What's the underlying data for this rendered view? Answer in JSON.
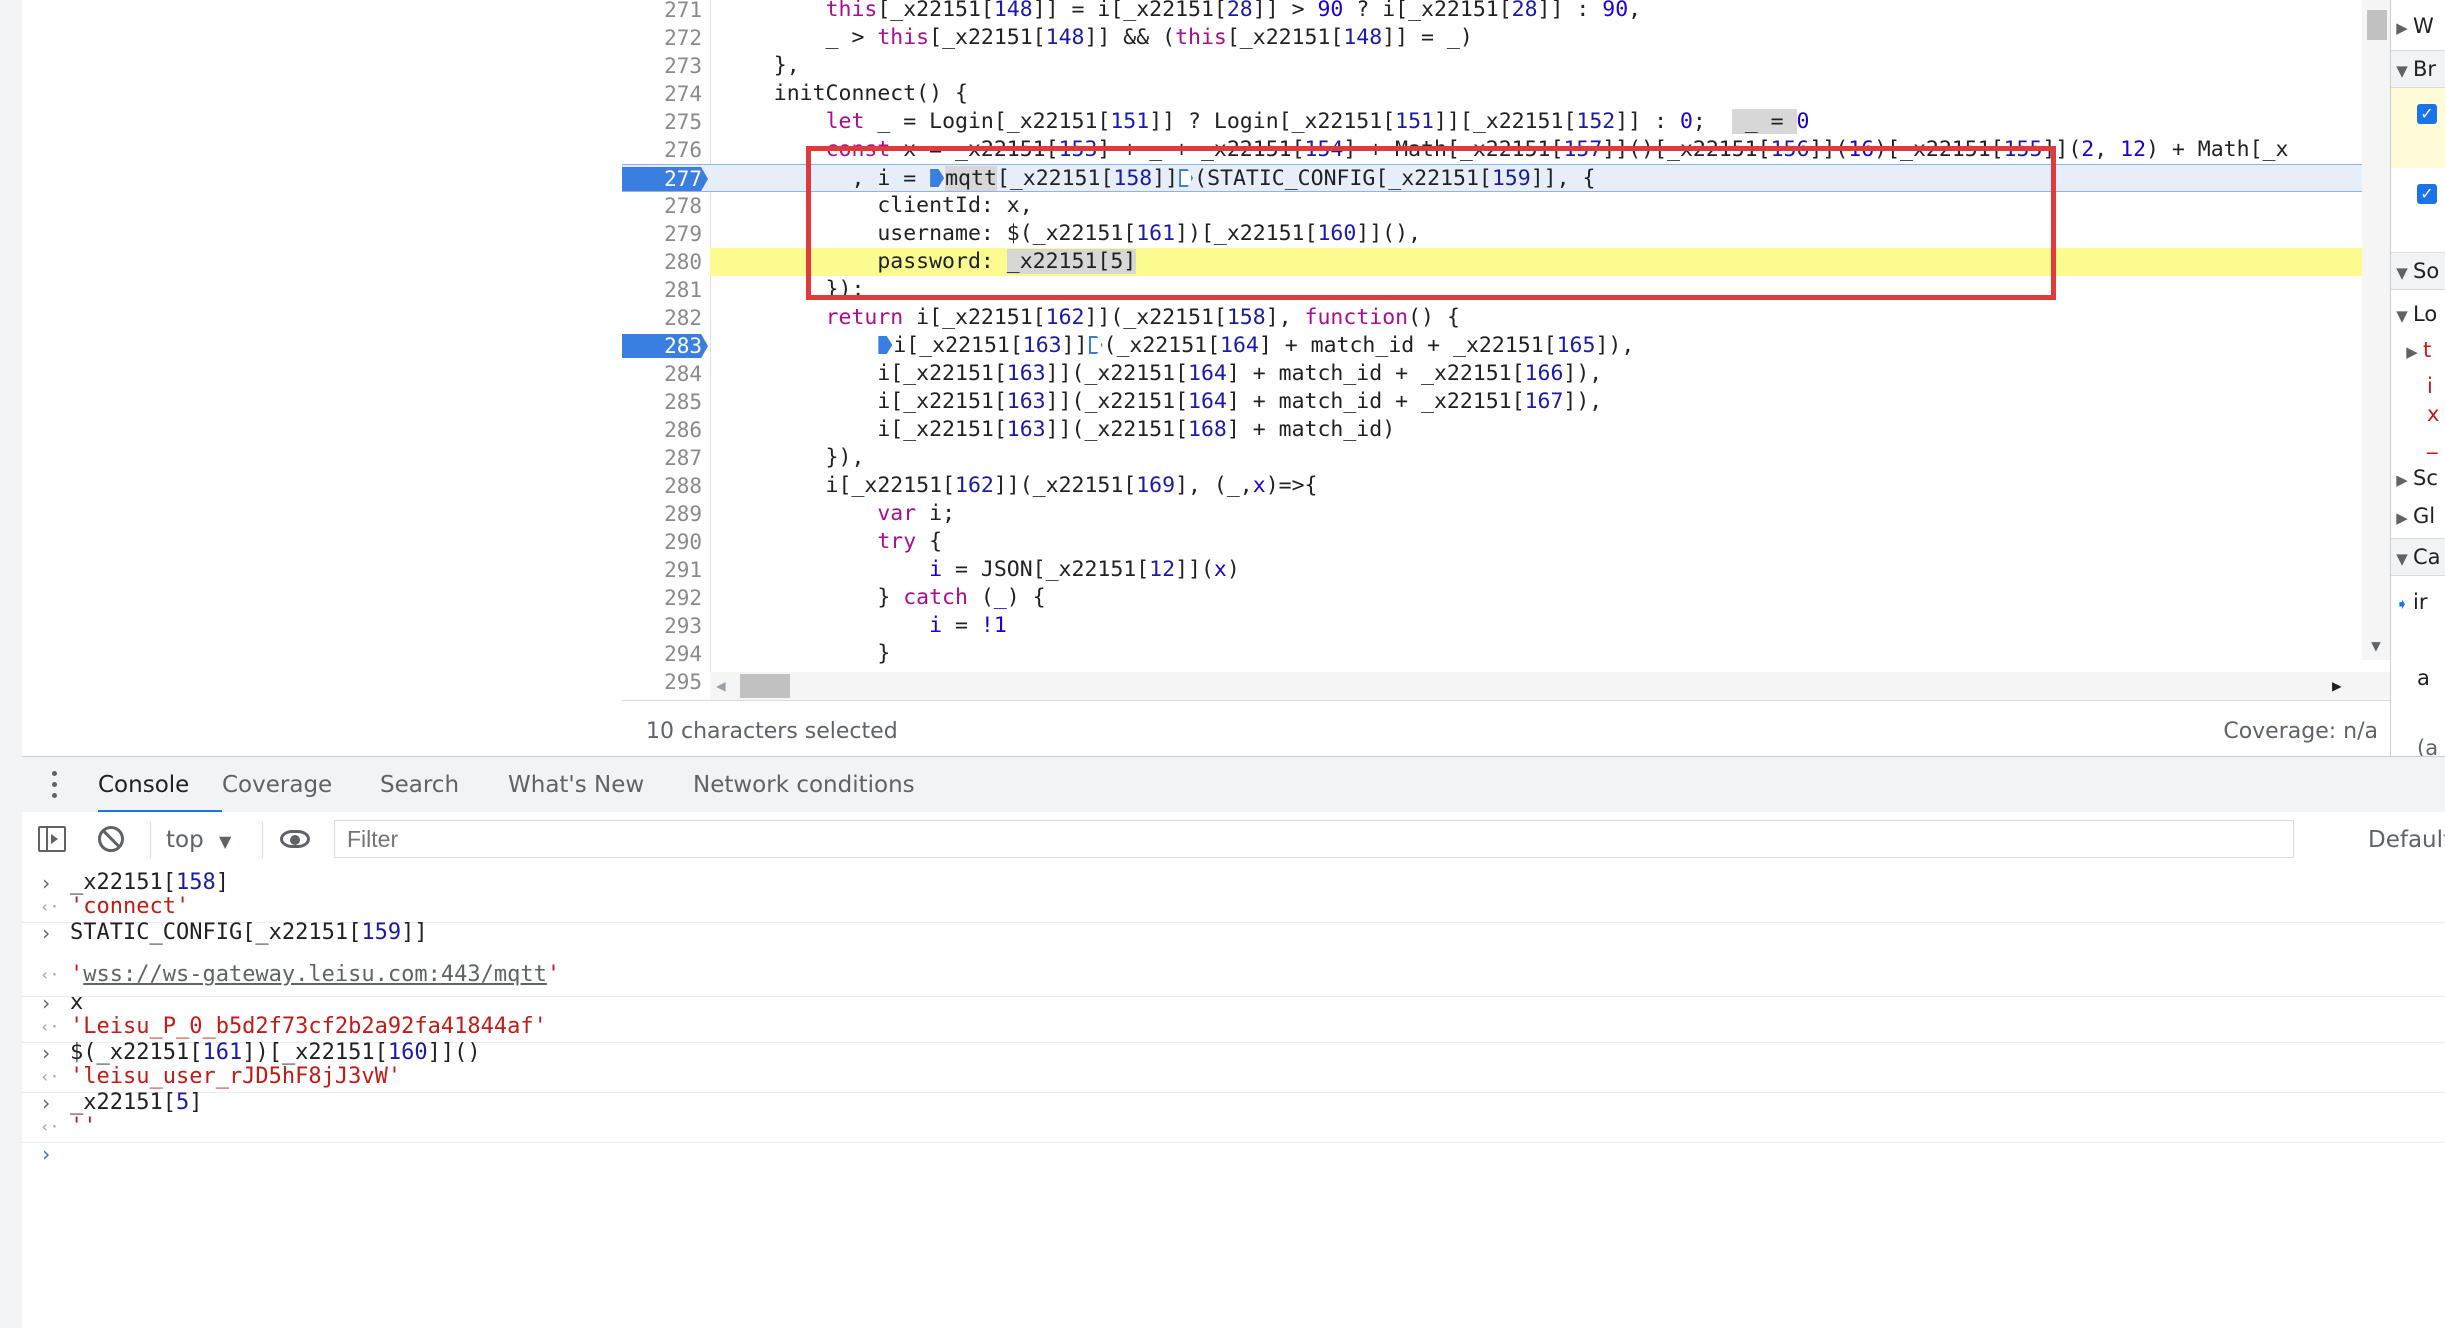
{
  "editor": {
    "lines": [
      {
        "n": "271",
        "code": [
          [
            "        ",
            ""
          ],
          [
            "this",
            "kw"
          ],
          [
            "[_x22151[",
            ""
          ],
          [
            "148",
            "idx"
          ],
          [
            "]] = i[_x22151[",
            ""
          ],
          [
            "28",
            "idx"
          ],
          [
            "]] > ",
            ""
          ],
          [
            "90",
            "num"
          ],
          [
            " ? i[_x22151[",
            ""
          ],
          [
            "28",
            "idx"
          ],
          [
            "]] : ",
            ""
          ],
          [
            "90",
            "num"
          ],
          [
            ",",
            ""
          ]
        ]
      },
      {
        "n": "272",
        "code": [
          [
            "        _ > ",
            ""
          ],
          [
            "this",
            "kw"
          ],
          [
            "[_x22151[",
            ""
          ],
          [
            "148",
            "idx"
          ],
          [
            "]] && (",
            ""
          ],
          [
            "this",
            "kw"
          ],
          [
            "[_x22151[",
            ""
          ],
          [
            "148",
            "idx"
          ],
          [
            "]] = _)",
            ""
          ]
        ]
      },
      {
        "n": "273",
        "code": [
          [
            "    },",
            ""
          ]
        ]
      },
      {
        "n": "274",
        "code": [
          [
            "    initConnect() {",
            ""
          ]
        ]
      },
      {
        "n": "275",
        "code": [
          [
            "        ",
            ""
          ],
          [
            "let",
            "kw"
          ],
          [
            " _ = Login[_x22151[",
            ""
          ],
          [
            "151",
            "idx"
          ],
          [
            "]] ? Login[_x22151[",
            ""
          ],
          [
            "151",
            "idx"
          ],
          [
            "]][_x22151[",
            ""
          ],
          [
            "152",
            "idx"
          ],
          [
            "]] : ",
            ""
          ],
          [
            "0",
            "num"
          ],
          [
            ";  ",
            ""
          ],
          [
            " _ = ",
            "sel"
          ],
          [
            "0",
            "num"
          ]
        ]
      },
      {
        "n": "276",
        "code": [
          [
            "        ",
            ""
          ],
          [
            "const",
            "kw"
          ],
          [
            " x = _x22151[",
            ""
          ],
          [
            "153",
            "idx"
          ],
          [
            "] + _ + _x22151[",
            ""
          ],
          [
            "154",
            "idx"
          ],
          [
            "] + Math[_x22151[",
            ""
          ],
          [
            "157",
            "idx"
          ],
          [
            "]]()[_x22151[",
            ""
          ],
          [
            "156",
            "idx"
          ],
          [
            "]](",
            ""
          ],
          [
            "16",
            "num"
          ],
          [
            ")[_x22151[",
            ""
          ],
          [
            "155",
            "idx"
          ],
          [
            "]](",
            ""
          ],
          [
            "2",
            "num"
          ],
          [
            ", ",
            ""
          ],
          [
            "12",
            "num"
          ],
          [
            ") + Math[_x",
            ""
          ]
        ]
      },
      {
        "n": "277",
        "code": [
          [
            "          , i = ",
            ""
          ],
          [
            "@in",
            ""
          ],
          [
            "mqtt",
            "sel"
          ],
          [
            "[_x22151[",
            ""
          ],
          [
            "158",
            "idx"
          ],
          [
            "]]",
            ""
          ],
          [
            "@out",
            ""
          ],
          [
            "(STATIC_CONFIG[_x22151[",
            ""
          ],
          [
            "159",
            "idx"
          ],
          [
            "]], {",
            ""
          ]
        ]
      },
      {
        "n": "278",
        "code": [
          [
            "            clientId: x,",
            ""
          ]
        ]
      },
      {
        "n": "279",
        "code": [
          [
            "            username: $(_x22151[",
            ""
          ],
          [
            "161",
            "idx"
          ],
          [
            "])[_x22151[",
            ""
          ],
          [
            "160",
            "idx"
          ],
          [
            "]](),",
            ""
          ]
        ]
      },
      {
        "n": "280",
        "code": [
          [
            "            password: ",
            ""
          ],
          [
            "_x22151[5]",
            "sel"
          ]
        ]
      },
      {
        "n": "281",
        "code": [
          [
            "        });",
            ""
          ]
        ]
      },
      {
        "n": "282",
        "code": [
          [
            "        ",
            ""
          ],
          [
            "return",
            "kw"
          ],
          [
            " i[_x22151[",
            ""
          ],
          [
            "162",
            "idx"
          ],
          [
            "]](_x22151[",
            ""
          ],
          [
            "158",
            "idx"
          ],
          [
            "], ",
            ""
          ],
          [
            "function",
            "kw"
          ],
          [
            "() {",
            ""
          ]
        ]
      },
      {
        "n": "283",
        "code": [
          [
            "            ",
            ""
          ],
          [
            "@in",
            ""
          ],
          [
            "i[_x22151[",
            ""
          ],
          [
            "163",
            "idx"
          ],
          [
            "]]",
            ""
          ],
          [
            "@out",
            ""
          ],
          [
            "(_x22151[",
            ""
          ],
          [
            "164",
            "idx"
          ],
          [
            "] + match_id + _x22151[",
            ""
          ],
          [
            "165",
            "idx"
          ],
          [
            "]),",
            ""
          ]
        ]
      },
      {
        "n": "284",
        "code": [
          [
            "            i[_x22151[",
            ""
          ],
          [
            "163",
            "idx"
          ],
          [
            "]](_x22151[",
            ""
          ],
          [
            "164",
            "idx"
          ],
          [
            "] + match_id + _x22151[",
            ""
          ],
          [
            "166",
            "idx"
          ],
          [
            "]),",
            ""
          ]
        ]
      },
      {
        "n": "285",
        "code": [
          [
            "            i[_x22151[",
            ""
          ],
          [
            "163",
            "idx"
          ],
          [
            "]](_x22151[",
            ""
          ],
          [
            "164",
            "idx"
          ],
          [
            "] + match_id + _x22151[",
            ""
          ],
          [
            "167",
            "idx"
          ],
          [
            "]),",
            ""
          ]
        ]
      },
      {
        "n": "286",
        "code": [
          [
            "            i[_x22151[",
            ""
          ],
          [
            "163",
            "idx"
          ],
          [
            "]](_x22151[",
            ""
          ],
          [
            "168",
            "idx"
          ],
          [
            "] + match_id)",
            ""
          ]
        ]
      },
      {
        "n": "287",
        "code": [
          [
            "        }),",
            ""
          ]
        ]
      },
      {
        "n": "288",
        "code": [
          [
            "        i[_x22151[",
            ""
          ],
          [
            "162",
            "idx"
          ],
          [
            "]](_x22151[",
            ""
          ],
          [
            "169",
            "idx"
          ],
          [
            "], (_,",
            ""
          ],
          [
            "x",
            "num"
          ],
          [
            ")=>{",
            ""
          ]
        ]
      },
      {
        "n": "289",
        "code": [
          [
            "            ",
            ""
          ],
          [
            "var",
            "kw"
          ],
          [
            " i;",
            ""
          ]
        ]
      },
      {
        "n": "290",
        "code": [
          [
            "            ",
            ""
          ],
          [
            "try",
            "kw"
          ],
          [
            " {",
            ""
          ]
        ]
      },
      {
        "n": "291",
        "code": [
          [
            "                ",
            ""
          ],
          [
            "i",
            "num"
          ],
          [
            " = JSON[_x22151[",
            ""
          ],
          [
            "12",
            "idx"
          ],
          [
            "]](",
            ""
          ],
          [
            "x",
            "num"
          ],
          [
            ")",
            ""
          ]
        ]
      },
      {
        "n": "292",
        "code": [
          [
            "            } ",
            ""
          ],
          [
            "catch",
            "kw"
          ],
          [
            " (",
            ""
          ],
          [
            "_",
            "num"
          ],
          [
            ") {",
            ""
          ]
        ]
      },
      {
        "n": "293",
        "code": [
          [
            "                ",
            ""
          ],
          [
            "i",
            "num"
          ],
          [
            " = ",
            ""
          ],
          [
            "!1",
            "num"
          ]
        ]
      },
      {
        "n": "294",
        "code": [
          [
            "            }",
            ""
          ]
        ]
      },
      {
        "n": "295",
        "code": [
          [
            "",
            ""
          ]
        ]
      }
    ],
    "breakpoint_lines": [
      "277",
      "283"
    ],
    "current_line": "277",
    "highlight_line": "280"
  },
  "status": {
    "selection": "10 characters selected",
    "coverage": "Coverage: n/a"
  },
  "right_panel": {
    "rows": [
      "W",
      "Br",
      "",
      "",
      "So",
      "Lo",
      "",
      "",
      "",
      "",
      "Sc",
      "Gl",
      "Ca",
      "ir",
      "",
      "a",
      "(a"
    ]
  },
  "drawer": {
    "tabs": [
      "Console",
      "Coverage",
      "Search",
      "What's New",
      "Network conditions"
    ],
    "active_tab": "Console"
  },
  "toolbar": {
    "context": "top",
    "filter_placeholder": "Filter",
    "levels": "Default"
  },
  "console": [
    {
      "kind": "input",
      "text": "_x22151[158]",
      "tokens": [
        [
          "_x22151[",
          ""
        ],
        [
          "158",
          "idx"
        ],
        [
          "]",
          ""
        ]
      ]
    },
    {
      "kind": "output",
      "text": "'connect'"
    },
    {
      "kind": "input",
      "text": "STATIC_CONFIG[_x22151[159]]",
      "tokens": [
        [
          "STATIC_CONFIG[_x22151[",
          ""
        ],
        [
          "159",
          "idx"
        ],
        [
          "]]",
          ""
        ]
      ]
    },
    {
      "kind": "output",
      "text": "'wss://ws-gateway.leisu.com:443/mqtt'",
      "link": true
    },
    {
      "kind": "input",
      "text": "x",
      "tokens": [
        [
          "x",
          ""
        ]
      ]
    },
    {
      "kind": "output",
      "text": "'Leisu_P_0_b5d2f73cf2b2a92fa41844af'"
    },
    {
      "kind": "input",
      "text": "$(_x22151[161])[_x22151[160]]()",
      "tokens": [
        [
          "$(_x22151[",
          ""
        ],
        [
          "161",
          "idx"
        ],
        [
          "])[_x22151[",
          ""
        ],
        [
          "160",
          "idx"
        ],
        [
          "]]()",
          ""
        ]
      ]
    },
    {
      "kind": "output",
      "text": "'leisu_user_rJD5hF8jJ3vW'"
    },
    {
      "kind": "input",
      "text": "_x22151[5]",
      "tokens": [
        [
          "_x22151[",
          ""
        ],
        [
          "5",
          "idx"
        ],
        [
          "]",
          ""
        ]
      ]
    },
    {
      "kind": "output",
      "text": "''"
    }
  ],
  "colors": {
    "accent": "#1a73e8",
    "breakpoint": "#3a7fe0",
    "highlight": "#fbfb8f",
    "annotation": "#e03a3a"
  }
}
